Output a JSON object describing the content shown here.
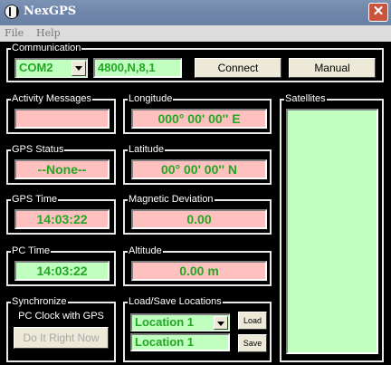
{
  "window": {
    "title": "NexGPS",
    "close_glyph": "✕"
  },
  "menu": [
    {
      "label": "File"
    },
    {
      "label": "Help"
    }
  ],
  "communication": {
    "legend": "Communication",
    "port_value": "COM2",
    "settings_value": "4800,N,8,1",
    "connect_label": "Connect",
    "manual_label": "Manual"
  },
  "activity": {
    "legend": "Activity Messages",
    "value": ""
  },
  "longitude": {
    "legend": "Longitude",
    "value": "000° 00' 00'' E"
  },
  "satellites": {
    "legend": "Satellites"
  },
  "gps_status": {
    "legend": "GPS Status",
    "value": "--None--"
  },
  "latitude": {
    "legend": "Latitude",
    "value": "00° 00' 00'' N"
  },
  "gps_time": {
    "legend": "GPS Time",
    "value": "14:03:22"
  },
  "magnetic_deviation": {
    "legend": "Magnetic Deviation",
    "value": "0.00"
  },
  "pc_time": {
    "legend": "PC Time",
    "value": "14:03:22"
  },
  "altitude": {
    "legend": "Altitude",
    "value": "0.00 m"
  },
  "synchronize": {
    "legend": "Synchronize",
    "text": "PC Clock with GPS",
    "button_label": "Do It Right Now"
  },
  "locations": {
    "legend": "Load/Save Locations",
    "select_value": "Location 1",
    "input_value": "Location 1",
    "load_label": "Load",
    "save_label": "Save"
  },
  "colors": {
    "pink_field": "#ffc0c0",
    "green_field": "#c0ffc0",
    "value_text": "#22a822",
    "titlebar": "#7089ad"
  }
}
